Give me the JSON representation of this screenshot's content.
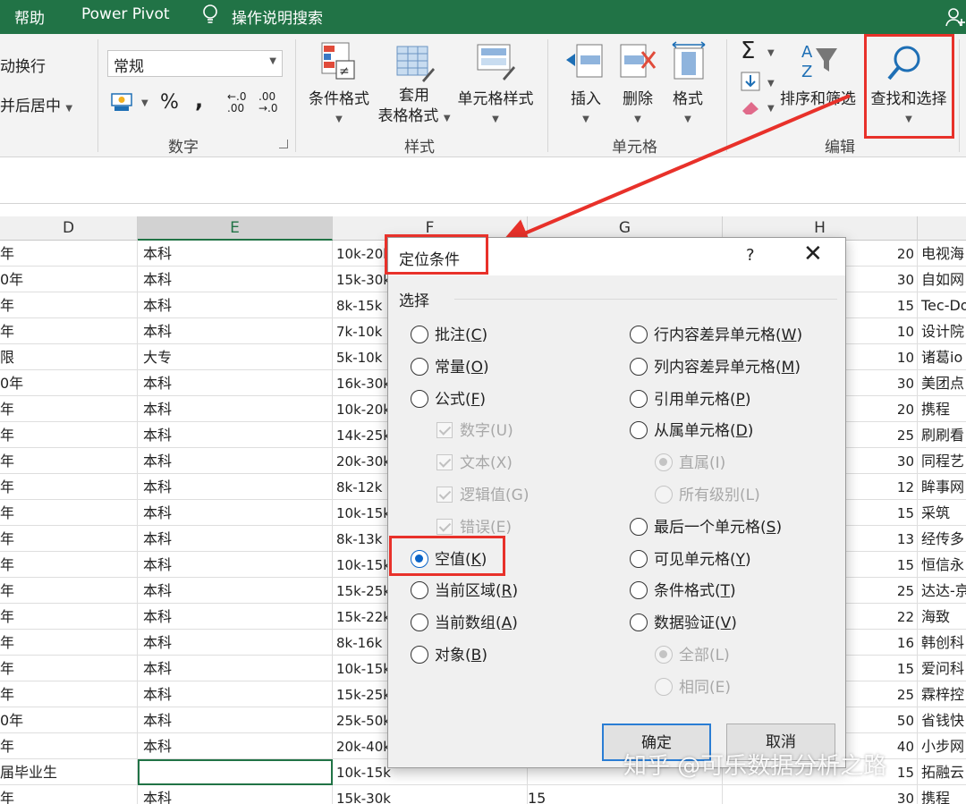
{
  "tabs": {
    "help": "帮助",
    "power_pivot": "Power Pivot",
    "search": "操作说明搜索"
  },
  "ribbon": {
    "wrap_text": "动换行",
    "merge_center": "并后居中",
    "number_format": "常规",
    "percent": "%",
    "comma": ",",
    "inc_dec": "←.0 .00",
    "dec_dec": ".00 →.0",
    "number_group": "数字",
    "cond_format": "条件格式",
    "table_format_1": "套用",
    "table_format_2": "表格格式",
    "cell_styles": "单元格样式",
    "styles_group": "样式",
    "insert": "插入",
    "delete": "删除",
    "format": "格式",
    "cells_group": "单元格",
    "sort_filter": "排序和筛选",
    "find_select": "查找和选择",
    "edit_group": "编辑"
  },
  "grid": {
    "columns": [
      "D",
      "E",
      "F",
      "G",
      "H"
    ],
    "rows": [
      [
        "年",
        "本科",
        "10k-20k",
        "",
        "20",
        "电视海"
      ],
      [
        "0年",
        "本科",
        "15k-30k",
        "",
        "30",
        "自如网"
      ],
      [
        "年",
        "本科",
        "8k-15k",
        "",
        "15",
        "Tec-Do"
      ],
      [
        "年",
        "本科",
        "7k-10k",
        "",
        "10",
        "设计院"
      ],
      [
        "限",
        "大专",
        "5k-10k",
        "",
        "10",
        "诸葛io"
      ],
      [
        "0年",
        "本科",
        "16k-30k",
        "",
        "30",
        "美团点"
      ],
      [
        "年",
        "本科",
        "10k-20k",
        "",
        "20",
        "携程"
      ],
      [
        "年",
        "本科",
        "14k-25k",
        "",
        "25",
        "刷刷看"
      ],
      [
        "年",
        "本科",
        "20k-30k",
        "",
        "30",
        "同程艺"
      ],
      [
        "年",
        "本科",
        "8k-12k",
        "",
        "12",
        "眸事网"
      ],
      [
        "年",
        "本科",
        "10k-15k",
        "",
        "15",
        "采筑"
      ],
      [
        "年",
        "本科",
        "8k-13k",
        "",
        "13",
        "经传多"
      ],
      [
        "年",
        "本科",
        "10k-15k",
        "",
        "15",
        "恒信永"
      ],
      [
        "年",
        "本科",
        "15k-25k",
        "",
        "25",
        "达达-京"
      ],
      [
        "年",
        "本科",
        "15k-22k",
        "",
        "22",
        "海致"
      ],
      [
        "年",
        "本科",
        "8k-16k",
        "",
        "16",
        "韩创科"
      ],
      [
        "年",
        "本科",
        "10k-15k",
        "",
        "15",
        "爱问科"
      ],
      [
        "年",
        "本科",
        "15k-25k",
        "",
        "25",
        "霖梓控"
      ],
      [
        "0年",
        "本科",
        "25k-50k",
        "",
        "50",
        "省钱快"
      ],
      [
        "年",
        "本科",
        "20k-40k",
        "",
        "40",
        "小步网"
      ],
      [
        "届毕业生",
        "",
        "10k-15k",
        "",
        "15",
        "拓融云"
      ],
      [
        "年",
        "本科",
        "15k-30k",
        "15",
        "30",
        "携程"
      ]
    ]
  },
  "dialog": {
    "title": "定位条件",
    "help": "?",
    "close": "✕",
    "group_label": "选择",
    "left": [
      {
        "pre": "批注(",
        "key": "C",
        "post": ")",
        "type": "radio",
        "state": "off"
      },
      {
        "pre": "常量(",
        "key": "O",
        "post": ")",
        "type": "radio",
        "state": "off"
      },
      {
        "pre": "公式(",
        "key": "F",
        "post": ")",
        "type": "radio",
        "state": "off"
      },
      {
        "pre": "数字(",
        "key": "U",
        "post": ")",
        "type": "check",
        "state": "disabled"
      },
      {
        "pre": "文本(",
        "key": "X",
        "post": ")",
        "type": "check",
        "state": "disabled"
      },
      {
        "pre": "逻辑值(",
        "key": "G",
        "post": ")",
        "type": "check",
        "state": "disabled"
      },
      {
        "pre": "错误(",
        "key": "E",
        "post": ")",
        "type": "check",
        "state": "disabled"
      },
      {
        "pre": "空值(",
        "key": "K",
        "post": ")",
        "type": "radio",
        "state": "on"
      },
      {
        "pre": "当前区域(",
        "key": "R",
        "post": ")",
        "type": "radio",
        "state": "off"
      },
      {
        "pre": "当前数组(",
        "key": "A",
        "post": ")",
        "type": "radio",
        "state": "off"
      },
      {
        "pre": "对象(",
        "key": "B",
        "post": ")",
        "type": "radio",
        "state": "off"
      }
    ],
    "right": [
      {
        "pre": "行内容差异单元格(",
        "key": "W",
        "post": ")",
        "type": "radio",
        "state": "off"
      },
      {
        "pre": "列内容差异单元格(",
        "key": "M",
        "post": ")",
        "type": "radio",
        "state": "off"
      },
      {
        "pre": "引用单元格(",
        "key": "P",
        "post": ")",
        "type": "radio",
        "state": "off"
      },
      {
        "pre": "从属单元格(",
        "key": "D",
        "post": ")",
        "type": "radio",
        "state": "off"
      },
      {
        "pre": "直属(",
        "key": "I",
        "post": ")",
        "type": "radio",
        "state": "disabled-on"
      },
      {
        "pre": "所有级别(",
        "key": "L",
        "post": ")",
        "type": "radio",
        "state": "disabled"
      },
      {
        "pre": "最后一个单元格(",
        "key": "S",
        "post": ")",
        "type": "radio",
        "state": "off"
      },
      {
        "pre": "可见单元格(",
        "key": "Y",
        "post": ")",
        "type": "radio",
        "state": "off"
      },
      {
        "pre": "条件格式(",
        "key": "T",
        "post": ")",
        "type": "radio",
        "state": "off"
      },
      {
        "pre": "数据验证(",
        "key": "V",
        "post": ")",
        "type": "radio",
        "state": "off"
      },
      {
        "pre": "全部(",
        "key": "L",
        "post": ")",
        "type": "radio",
        "state": "disabled-on"
      },
      {
        "pre": "相同(",
        "key": "E",
        "post": ")",
        "type": "radio",
        "state": "disabled"
      }
    ],
    "ok": "确定",
    "cancel": "取消"
  },
  "watermark": "知乎 @可乐数据分析之路",
  "colors": {
    "excel_green": "#217346",
    "highlight_red": "#e8312a",
    "radio_blue": "#0a64c8"
  }
}
